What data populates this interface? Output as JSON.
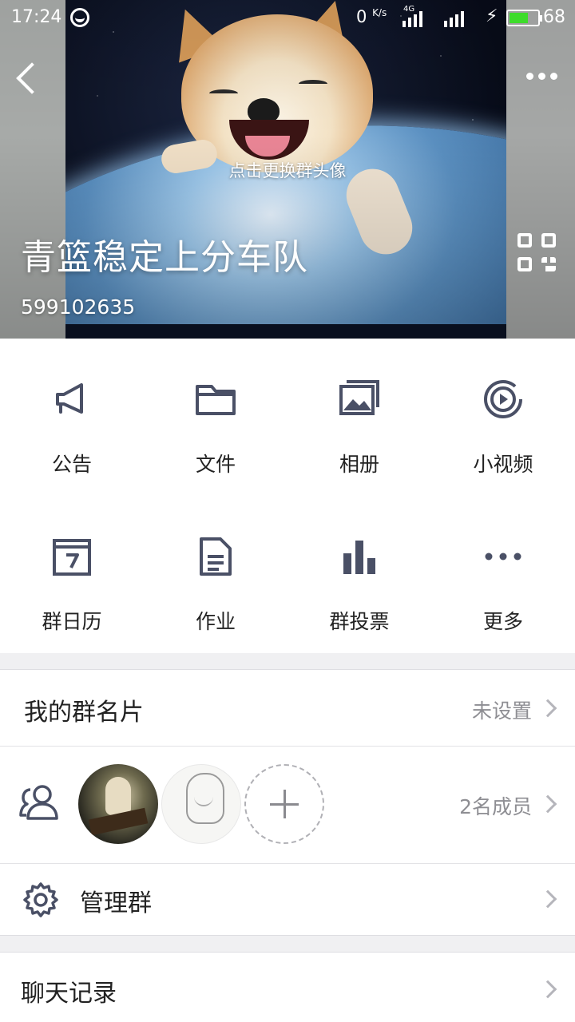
{
  "status_bar": {
    "time": "17:24",
    "net_speed": "0",
    "net_speed_unit": "K/s",
    "network_label": "4G",
    "battery_level": "68",
    "battery_fraction": 0.68
  },
  "header": {
    "change_avatar_hint": "点击更换群头像",
    "group_name": "青篮稳定上分车队",
    "group_id": "599102635",
    "icons": {
      "back": "back-arrow-icon",
      "more": "more-dots-icon",
      "qr": "qr-code-icon"
    }
  },
  "features": [
    {
      "label": "公告",
      "icon": "megaphone-icon"
    },
    {
      "label": "文件",
      "icon": "folder-icon"
    },
    {
      "label": "相册",
      "icon": "photo-album-icon"
    },
    {
      "label": "小视频",
      "icon": "video-play-icon"
    },
    {
      "label": "群日历",
      "icon": "calendar-icon"
    },
    {
      "label": "作业",
      "icon": "document-icon"
    },
    {
      "label": "群投票",
      "icon": "bar-chart-icon"
    },
    {
      "label": "更多",
      "icon": "more-dots-icon"
    }
  ],
  "my_card": {
    "label": "我的群名片",
    "value": "未设置"
  },
  "members": {
    "count_text": "2名成员",
    "icon": "members-icon",
    "add_icon": "add-member-icon"
  },
  "manage": {
    "label": "管理群",
    "icon": "gear-icon"
  },
  "chat_history": {
    "label": "聊天记录"
  },
  "colors": {
    "icon_gray": "#4a5066",
    "text_main": "#222222",
    "text_secondary": "#8e8e93",
    "battery_green": "#3ddc2b"
  }
}
